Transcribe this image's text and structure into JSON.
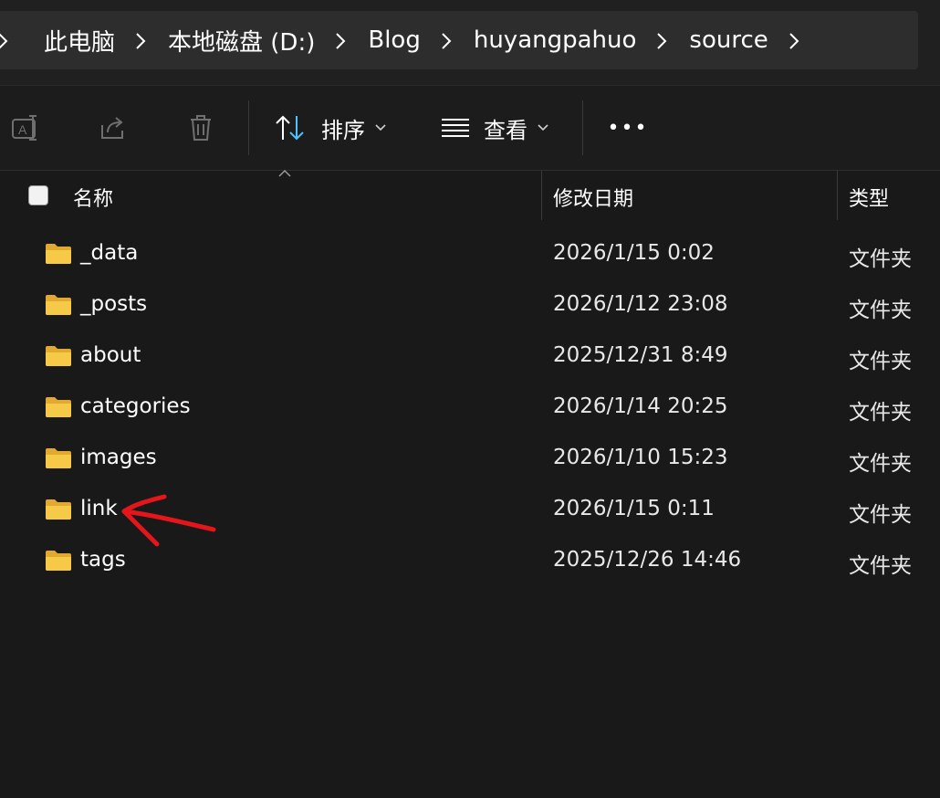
{
  "breadcrumb": {
    "items": [
      {
        "label": "此电脑"
      },
      {
        "label": "本地磁盘 (D:)"
      },
      {
        "label": "Blog"
      },
      {
        "label": "huyangpahuo"
      },
      {
        "label": "source"
      }
    ]
  },
  "toolbar": {
    "sort_label": "排序",
    "view_label": "查看",
    "more_label": "•••",
    "icons": [
      "rename-icon",
      "share-icon",
      "delete-icon",
      "sort-icon",
      "view-icon",
      "more-icon"
    ]
  },
  "columns": {
    "name": "名称",
    "date": "修改日期",
    "type": "类型"
  },
  "files": [
    {
      "name": "_data",
      "date": "2026/1/15 0:02",
      "type": "文件夹"
    },
    {
      "name": "_posts",
      "date": "2026/1/12 23:08",
      "type": "文件夹"
    },
    {
      "name": "about",
      "date": "2025/12/31 8:49",
      "type": "文件夹"
    },
    {
      "name": "categories",
      "date": "2026/1/14 20:25",
      "type": "文件夹"
    },
    {
      "name": "images",
      "date": "2026/1/10 15:23",
      "type": "文件夹"
    },
    {
      "name": "link",
      "date": "2026/1/15 0:11",
      "type": "文件夹"
    },
    {
      "name": "tags",
      "date": "2025/12/26 14:46",
      "type": "文件夹"
    }
  ],
  "colors": {
    "folder_front": "#f7c948",
    "folder_back": "#e3a92e",
    "annotation": "#e5161b",
    "background": "#191919"
  }
}
